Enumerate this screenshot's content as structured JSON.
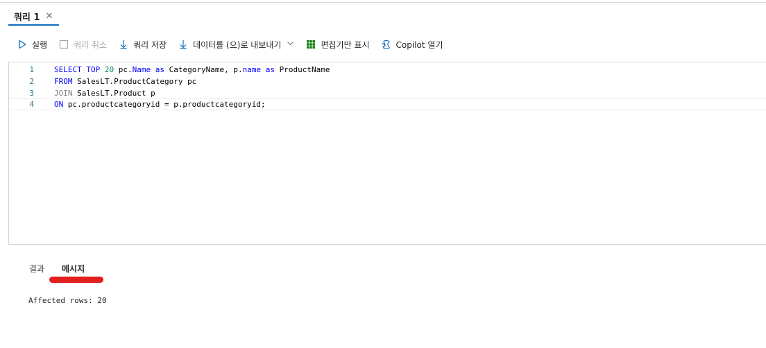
{
  "tab": {
    "title": "쿼리 1",
    "close_glyph": "✕"
  },
  "toolbar": {
    "run": "실행",
    "cancel": "쿼리 취소",
    "save": "쿼리 저장",
    "export": "데이터를 (으)로 내보내기",
    "edit_only": "편집기만 표시",
    "copilot": "Copilot 열기",
    "accent_color": "#0f6cbd",
    "grid_icon_color": "#107c10"
  },
  "editor": {
    "lines": [
      {
        "num": "1",
        "code": "SELECT TOP 20 pc.Name as CategoryName, p.name as ProductName"
      },
      {
        "num": "2",
        "code": "FROM SalesLT.ProductCategory pc"
      },
      {
        "num": "3",
        "code": "JOIN SalesLT.Product p"
      },
      {
        "num": "4",
        "code": "ON pc.productcategoryid = p.productcategoryid;"
      }
    ]
  },
  "results": {
    "tabs": {
      "results": "결과",
      "messages": "메시지"
    },
    "active_tab": "메시지",
    "message": "Affected rows: 20",
    "highlight_color": "#e0201e"
  }
}
